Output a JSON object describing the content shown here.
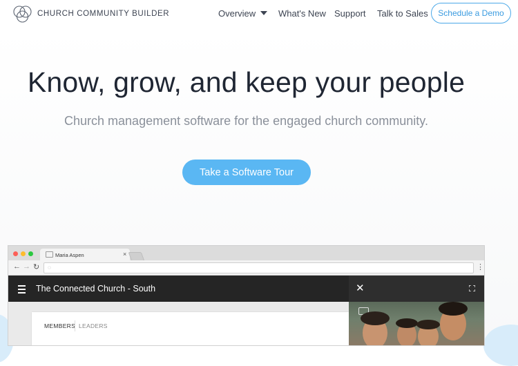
{
  "header": {
    "brand": "CHURCH COMMUNITY BUILDER",
    "nav": {
      "overview": "Overview",
      "whats_new": "What's New",
      "support": "Support",
      "talk_to_sales": "Talk to Sales"
    },
    "demo_button": "Schedule a Demo"
  },
  "hero": {
    "title": "Know, grow, and keep your people",
    "subtitle": "Church management software for the engaged church community.",
    "cta": "Take a Software Tour"
  },
  "browser_mock": {
    "tab_title": "Maria Aspen",
    "tab_close": "×",
    "app_title": "The Connected Church - South",
    "panel_close": "✕",
    "tabs": {
      "members": "MEMBERS",
      "leaders": "LEADERS"
    }
  },
  "colors": {
    "accent": "#5ab7f3",
    "outline_button": "#4aa8e8",
    "app_bar": "#252525",
    "title_text": "#1f2633",
    "subtitle_text": "#8a909a"
  }
}
